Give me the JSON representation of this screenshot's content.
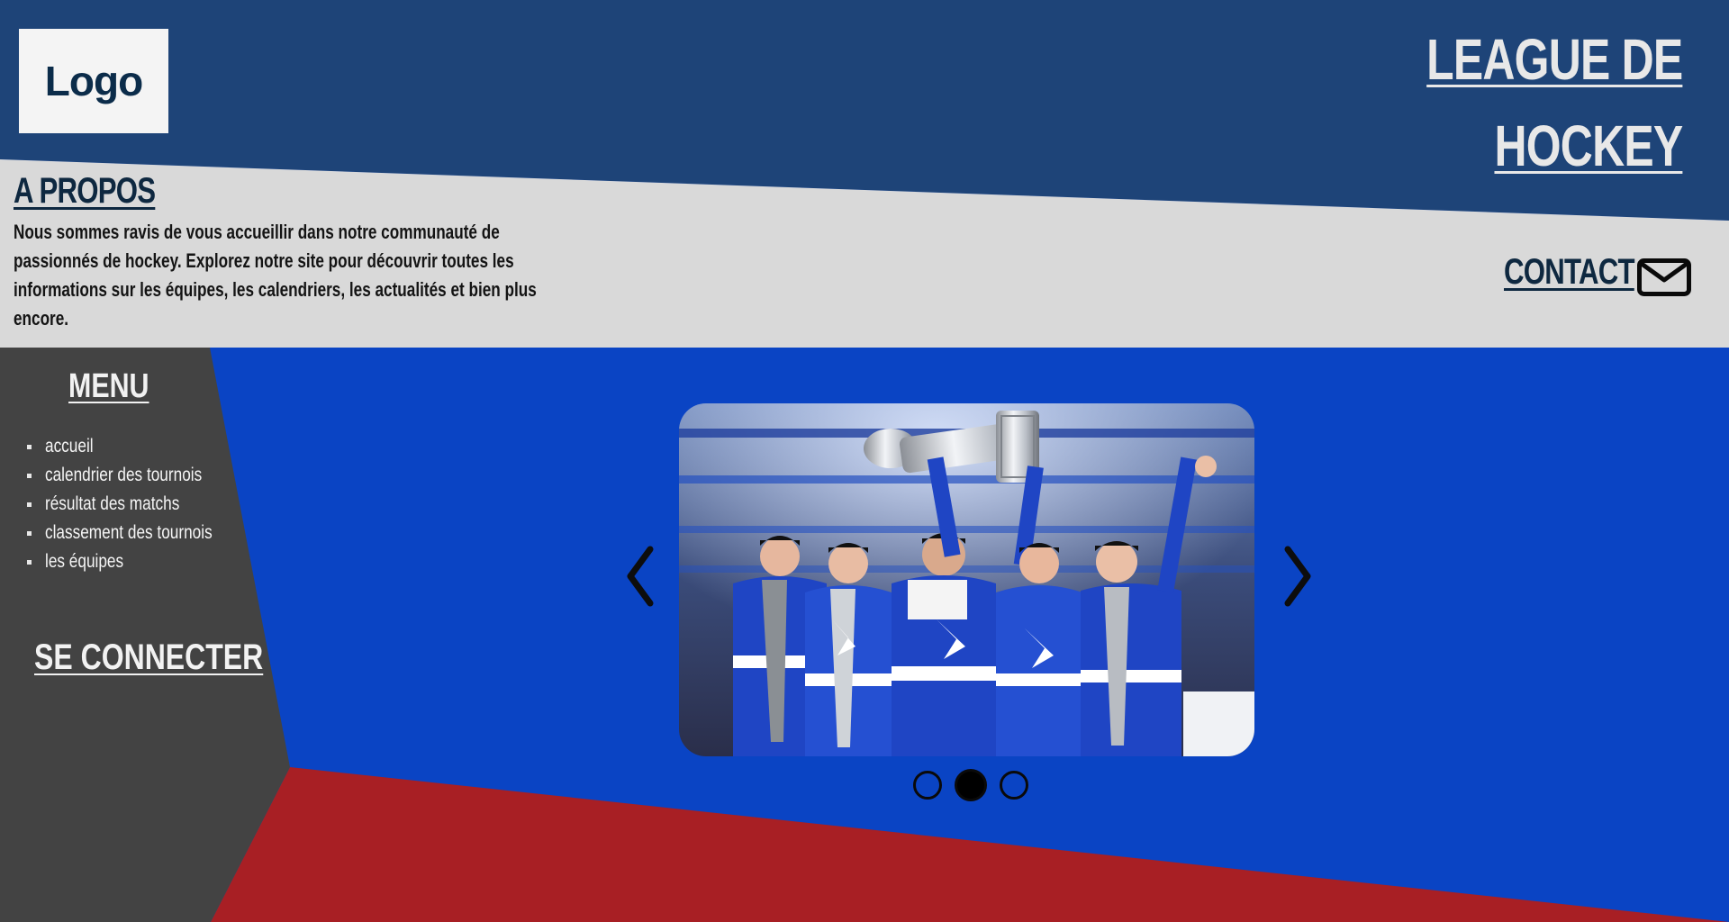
{
  "header": {
    "logo_label": "Logo",
    "title_line1": "LEAGUE DE",
    "title_line2": "HOCKEY"
  },
  "about": {
    "title": "A PROPOS",
    "text": "Nous sommes ravis de vous accueillir dans notre communauté de passionnés de hockey.  Explorez notre site pour découvrir toutes les informations sur les équipes, les calendriers, les actualités et bien plus encore."
  },
  "contact": {
    "label": "CONTACT",
    "icon": "mail-icon"
  },
  "sidebar": {
    "menu_title": "MENU",
    "items": [
      {
        "label": "accueil"
      },
      {
        "label": "calendrier des tournois"
      },
      {
        "label": "résultat des matchs"
      },
      {
        "label": "classement des tournois"
      },
      {
        "label": "les équipes"
      }
    ],
    "login_label": "SE CONNECTER"
  },
  "carousel": {
    "slide_count": 3,
    "active_slide": 2,
    "image": "hockey-team-celebrating-with-trophy"
  },
  "colors": {
    "header_navy": "#1e4478",
    "band_gray": "#d9d9d9",
    "main_blue": "#0a44c4",
    "sidebar_gray": "#434343",
    "accent_red": "#a81f24"
  }
}
